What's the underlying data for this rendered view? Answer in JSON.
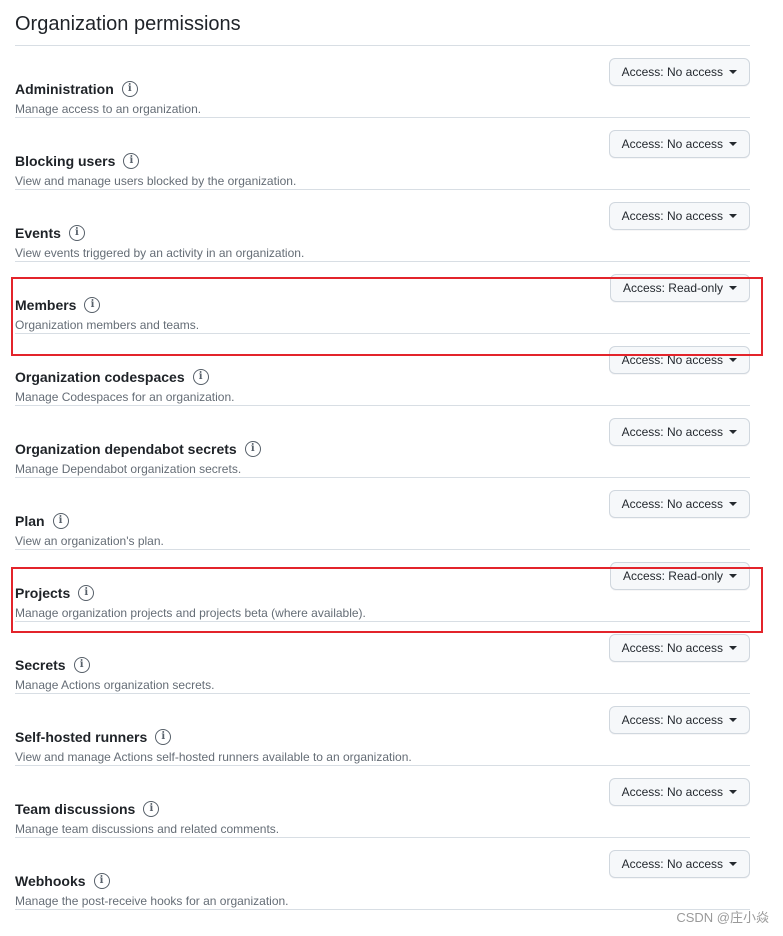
{
  "title": "Organization permissions",
  "permissions": [
    {
      "name": "Administration",
      "description": "Manage access to an organization.",
      "access": "Access: No access"
    },
    {
      "name": "Blocking users",
      "description": "View and manage users blocked by the organization.",
      "access": "Access: No access"
    },
    {
      "name": "Events",
      "description": "View events triggered by an activity in an organization.",
      "access": "Access: No access"
    },
    {
      "name": "Members",
      "description": "Organization members and teams.",
      "access": "Access: Read-only",
      "highlighted": true
    },
    {
      "name": "Organization codespaces",
      "description": "Manage Codespaces for an organization.",
      "access": "Access: No access"
    },
    {
      "name": "Organization dependabot secrets",
      "description": "Manage Dependabot organization secrets.",
      "access": "Access: No access"
    },
    {
      "name": "Plan",
      "description": "View an organization's plan.",
      "access": "Access: No access"
    },
    {
      "name": "Projects",
      "description": "Manage organization projects and projects beta (where available).",
      "access": "Access: Read-only",
      "highlighted": true
    },
    {
      "name": "Secrets",
      "description": "Manage Actions organization secrets.",
      "access": "Access: No access"
    },
    {
      "name": "Self-hosted runners",
      "description": "View and manage Actions self-hosted runners available to an organization.",
      "access": "Access: No access"
    },
    {
      "name": "Team discussions",
      "description": "Manage team discussions and related comments.",
      "access": "Access: No access"
    },
    {
      "name": "Webhooks",
      "description": "Manage the post-receive hooks for an organization.",
      "access": "Access: No access"
    }
  ],
  "info_icon_glyph": "i",
  "highlight_color": "#e3242b",
  "watermark": "CSDN @庄小焱"
}
